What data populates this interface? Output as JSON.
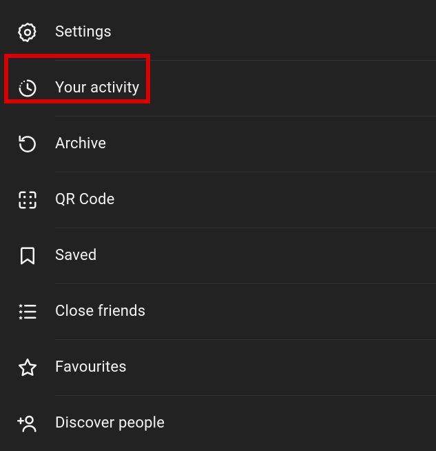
{
  "menu": {
    "items": [
      {
        "key": "settings",
        "label": "Settings"
      },
      {
        "key": "your-activity",
        "label": "Your activity"
      },
      {
        "key": "archive",
        "label": "Archive"
      },
      {
        "key": "qr-code",
        "label": "QR Code"
      },
      {
        "key": "saved",
        "label": "Saved"
      },
      {
        "key": "close-friends",
        "label": "Close friends"
      },
      {
        "key": "favourites",
        "label": "Favourites"
      },
      {
        "key": "discover-people",
        "label": "Discover people"
      }
    ]
  },
  "annotation": {
    "highlight_item_key": "your-activity",
    "color": "#d80000"
  }
}
